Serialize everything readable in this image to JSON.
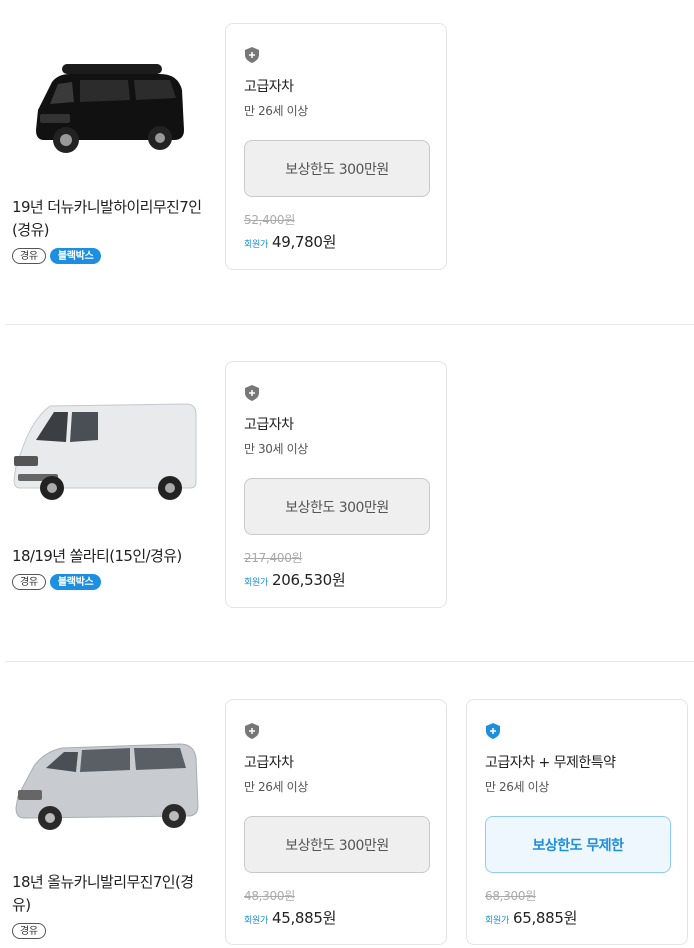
{
  "colors": {
    "accent": "#1d8fdd",
    "tag_blue": "#1e8fe0",
    "border": "#e4e4e4"
  },
  "cars": [
    {
      "title": "19년 더뉴카니발하이리무진7인(경유)",
      "car_icon": "black-minivan-highroof-image",
      "tags": [
        "경유",
        "블랙박스"
      ],
      "plans": [
        {
          "icon": "shield-icon",
          "name": "고급자차",
          "age": "만 26세 이상",
          "limit": "보상한도 300만원",
          "original_price": "52,400원",
          "member_label": "회원가",
          "member_price": "49,780원"
        }
      ]
    },
    {
      "title": "18/19년 쏠라티(15인/경유)",
      "car_icon": "white-van-image",
      "tags": [
        "경유",
        "블랙박스"
      ],
      "plans": [
        {
          "icon": "shield-icon",
          "name": "고급자차",
          "age": "만 30세 이상",
          "limit": "보상한도 300만원",
          "original_price": "217,400원",
          "member_label": "회원가",
          "member_price": "206,530원"
        }
      ]
    },
    {
      "title": "18년 올뉴카니발리무진7인(경유)",
      "car_icon": "silver-minivan-image",
      "tags": [
        "경유"
      ],
      "plans": [
        {
          "icon": "shield-icon",
          "name": "고급자차",
          "age": "만 26세 이상",
          "limit": "보상한도 300만원",
          "original_price": "48,300원",
          "member_label": "회원가",
          "member_price": "45,885원"
        },
        {
          "icon": "shield-plus-icon",
          "name": "고급자차 + 무제한특약",
          "age": "만 26세 이상",
          "limit": "보상한도 무제한",
          "original_price": "68,300원",
          "member_label": "회원가",
          "member_price": "65,885원"
        }
      ]
    }
  ]
}
